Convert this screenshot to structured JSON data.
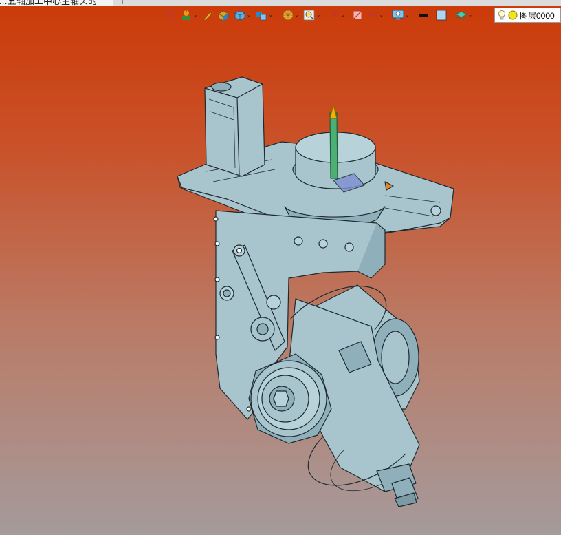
{
  "window": {
    "tab_title": "…五轴加工中心主轴头的",
    "tab_close": "×"
  },
  "toolbar": {
    "items": [
      {
        "name": "exit-sketch-icon",
        "has_dropdown": false
      },
      {
        "name": "move-part-icon",
        "has_dropdown": true
      },
      {
        "name": "pencil-edit-icon",
        "has_dropdown": false
      },
      {
        "name": "shaded-with-edges-icon",
        "has_dropdown": false
      },
      {
        "name": "box-display-icon",
        "has_dropdown": true
      },
      {
        "name": "view-orientation-icon",
        "has_dropdown": true
      },
      {
        "name": "render-sphere-icon",
        "has_dropdown": true
      },
      {
        "name": "zoom-fit-icon",
        "has_dropdown": true
      },
      {
        "name": "origin-axes-icon",
        "has_dropdown": true
      },
      {
        "name": "section-view-icon",
        "has_dropdown": false
      },
      {
        "name": "dimension-icon",
        "has_dropdown": true
      },
      {
        "name": "display-monitor-icon",
        "has_dropdown": true
      },
      {
        "name": "line-color-icon",
        "has_dropdown": false
      },
      {
        "name": "face-color-icon",
        "has_dropdown": false
      },
      {
        "name": "layer-stack-icon",
        "has_dropdown": true
      }
    ],
    "dropdown_glyph": "⌄"
  },
  "layer": {
    "label": "图层0000"
  },
  "colors": {
    "model_fill": "#a8c4cc",
    "model_shade": "#8fb0ba",
    "model_line": "#1c2a30",
    "bg_top": "#cc3a08",
    "bg_bottom": "#a59a9c"
  }
}
